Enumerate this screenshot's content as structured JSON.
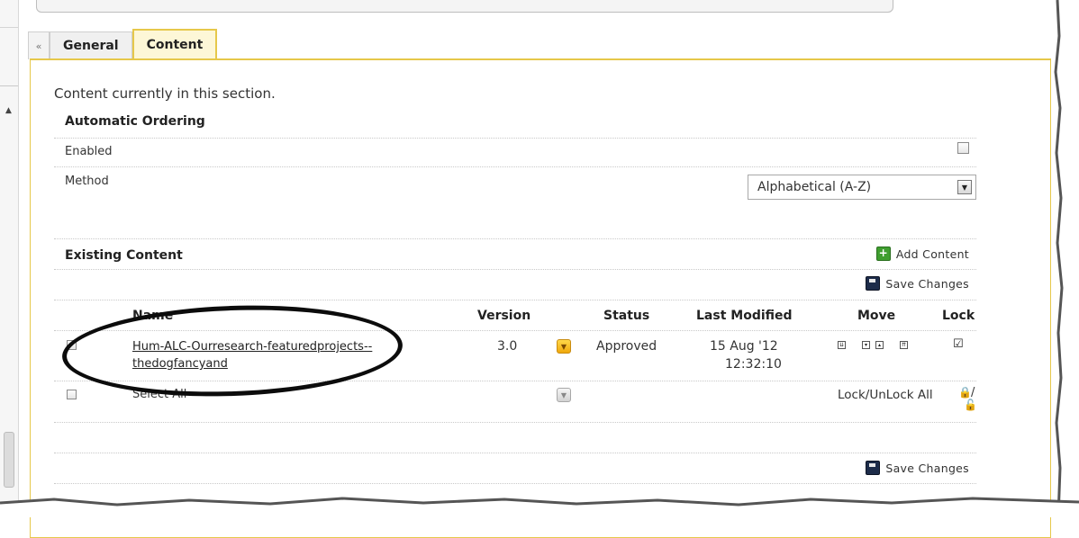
{
  "tabs": [
    {
      "label": "General"
    },
    {
      "label": "Content"
    }
  ],
  "intro_text": "Content currently in this section.",
  "automatic_ordering": {
    "heading": "Automatic Ordering",
    "enabled_label": "Enabled",
    "enabled_checked": false,
    "method_label": "Method",
    "method_value": "Alphabetical (A-Z)"
  },
  "existing_content": {
    "heading": "Existing Content",
    "add_content_label": "Add Content",
    "save_changes_label": "Save Changes",
    "columns": {
      "name": "Name",
      "version": "Version",
      "status": "Status",
      "last_modified": "Last Modified",
      "move": "Move",
      "lock": "Lock"
    },
    "rows": [
      {
        "name_line1": "Hum-ALC-Ourresearch-featuredprojects--",
        "name_line2": "thedogfancyand",
        "version": "3.0",
        "status": "Approved",
        "last_modified_date": "15 Aug '12",
        "last_modified_time": "12:32:10",
        "locked": true
      }
    ],
    "select_all_label": "Select All",
    "lock_unlock_all_label": "Lock/UnLock All",
    "lock_separator": "/"
  },
  "icons": {
    "tab_back": "double-chevron-left-icon",
    "add": "plus-icon",
    "save": "floppy-disk-icon",
    "status": "chevron-down-icon",
    "move": [
      "move-bottom-icon",
      "move-down-icon",
      "move-up-icon",
      "move-top-icon"
    ],
    "lock": "padlock-icon",
    "unlock": "open-padlock-icon"
  },
  "colors": {
    "tab_accent": "#e6c84a",
    "tab_active_bg": "#fdf7d7",
    "status_active": "#f0a80c"
  }
}
